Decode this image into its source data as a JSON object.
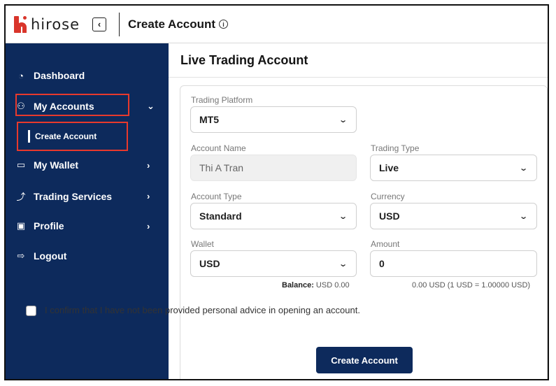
{
  "header": {
    "logo_text": "hirose",
    "collapse_icon": "chevron-left-icon",
    "page_title": "Create Account",
    "info_icon": "info-icon"
  },
  "sidebar": {
    "items": [
      {
        "label": "Dashboard",
        "icon": "dashboard-icon"
      },
      {
        "label": "My Accounts",
        "icon": "accounts-icon",
        "expanded": true
      },
      {
        "label": "My Wallet",
        "icon": "wallet-icon"
      },
      {
        "label": "Trading Services",
        "icon": "chart-icon"
      },
      {
        "label": "Profile",
        "icon": "profile-icon"
      },
      {
        "label": "Logout",
        "icon": "logout-icon"
      }
    ],
    "sub_item": {
      "label": "Create Account"
    },
    "colors": {
      "background": "#0d2a5c",
      "highlight": "#e8392c"
    }
  },
  "main": {
    "title": "Live Trading Account",
    "form": {
      "trading_platform": {
        "label": "Trading Platform",
        "value": "MT5"
      },
      "account_name": {
        "label": "Account Name",
        "value": "Thi A Tran"
      },
      "trading_type": {
        "label": "Trading Type",
        "value": "Live"
      },
      "account_type": {
        "label": "Account Type",
        "value": "Standard"
      },
      "currency": {
        "label": "Currency",
        "value": "USD"
      },
      "wallet": {
        "label": "Wallet",
        "value": "USD"
      },
      "amount": {
        "label": "Amount",
        "value": "0"
      },
      "balance_label": "Balance:",
      "balance_value": "USD 0.00",
      "conversion_note": "0.00 USD (1 USD = 1.00000 USD)",
      "confirm_text": "I confirm that I have not been provided personal advice in opening an account.",
      "submit_label": "Create Account"
    }
  }
}
